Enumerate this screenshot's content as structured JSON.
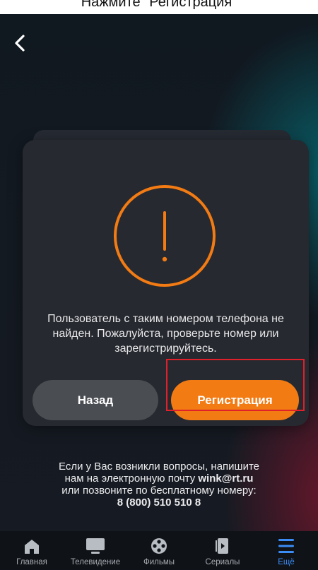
{
  "caption": "Нажмите \"Регистрация\"",
  "dialog": {
    "message_line1": "Пользователь с таким номером телефона не",
    "message_line2": "найден. Пожалуйста, проверьте номер или",
    "message_line3": "зарегистрируйтесь.",
    "back_label": "Назад",
    "register_label": "Регистрация"
  },
  "contact": {
    "line1": "Если у Вас возникли вопросы, напишите",
    "line2_prefix": "нам на электронную почту",
    "email": "wink@rt.ru",
    "line3": "или позвоните по бесплатному номеру:",
    "phone": "8 (800) 510 510 8"
  },
  "tabbar": {
    "items": [
      {
        "label": "Главная",
        "icon": "home-icon"
      },
      {
        "label": "Телевидение",
        "icon": "tv-icon"
      },
      {
        "label": "Фильмы",
        "icon": "film-reel-icon"
      },
      {
        "label": "Сериалы",
        "icon": "series-icon"
      },
      {
        "label": "Ещё",
        "icon": "menu-icon"
      }
    ],
    "active_index": 4
  },
  "colors": {
    "accent": "#f37b14",
    "active_tab": "#3b8cf5",
    "highlight_frame": "#e0202a"
  }
}
